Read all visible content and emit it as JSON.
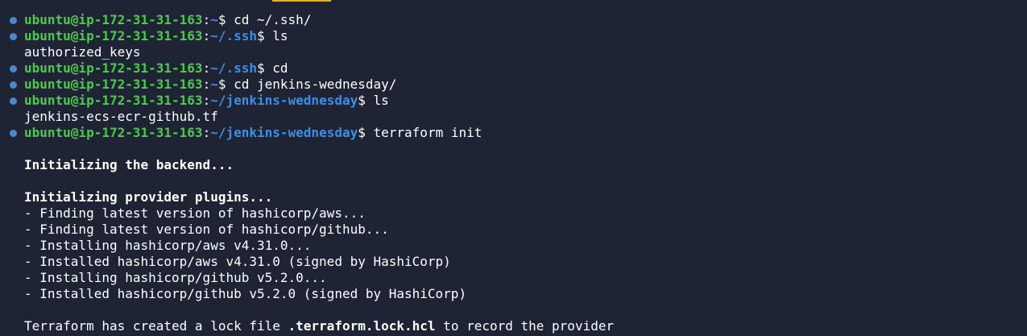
{
  "prompt": {
    "user_host": "ubuntu@ip-172-31-31-163",
    "colon": ":",
    "dollar": "$"
  },
  "lines": [
    {
      "type": "cmd",
      "path": "~",
      "command": " cd ~/.ssh/"
    },
    {
      "type": "cmd",
      "path": "~/.ssh",
      "command": " ls"
    },
    {
      "type": "out",
      "text": "authorized_keys"
    },
    {
      "type": "cmd",
      "path": "~/.ssh",
      "command": " cd"
    },
    {
      "type": "cmd",
      "path": "~",
      "command": " cd jenkins-wednesday/"
    },
    {
      "type": "cmd",
      "path": "~/jenkins-wednesday",
      "command": " ls"
    },
    {
      "type": "out",
      "text": "jenkins-ecs-ecr-github.tf"
    },
    {
      "type": "cmd",
      "path": "~/jenkins-wednesday",
      "command": " terraform init"
    },
    {
      "type": "out",
      "text": ""
    },
    {
      "type": "out",
      "text": "Initializing the backend...",
      "bold": true
    },
    {
      "type": "out",
      "text": ""
    },
    {
      "type": "out",
      "text": "Initializing provider plugins...",
      "bold": true
    },
    {
      "type": "out",
      "text": "- Finding latest version of hashicorp/aws..."
    },
    {
      "type": "out",
      "text": "- Finding latest version of hashicorp/github..."
    },
    {
      "type": "out",
      "text": "- Installing hashicorp/aws v4.31.0..."
    },
    {
      "type": "out",
      "text": "- Installed hashicorp/aws v4.31.0 (signed by HashiCorp)"
    },
    {
      "type": "out",
      "text": "- Installing hashicorp/github v5.2.0..."
    },
    {
      "type": "out",
      "text": "- Installed hashicorp/github v5.2.0 (signed by HashiCorp)"
    },
    {
      "type": "out",
      "text": ""
    },
    {
      "type": "mixed",
      "parts": [
        {
          "text": "Terraform has created a lock file ",
          "bold": false
        },
        {
          "text": ".terraform.lock.hcl",
          "bold": true
        },
        {
          "text": " to record the provider",
          "bold": false
        }
      ]
    }
  ],
  "colors": {
    "background": "#1e2433",
    "user": "#4ec94e",
    "path": "#3b8eea",
    "dot": "#4d89c8",
    "tab_accent": "#f0b400"
  }
}
